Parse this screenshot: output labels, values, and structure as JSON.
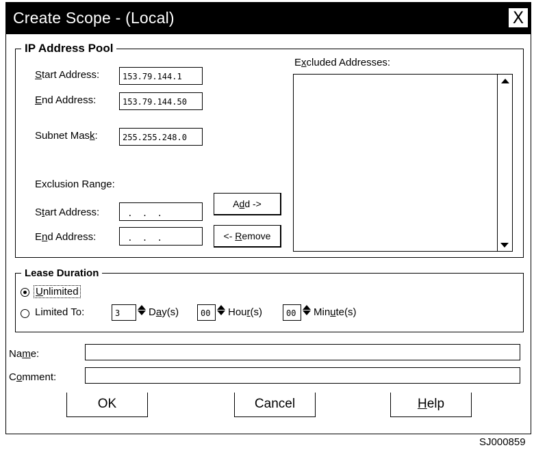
{
  "window": {
    "title": "Create Scope - (Local)",
    "close_label": "X"
  },
  "ip_pool": {
    "legend": "IP Address Pool",
    "start_address_label": [
      "",
      "S",
      "tart Address:"
    ],
    "start_address_value": "153.79.144.1",
    "end_address_label": [
      "",
      "E",
      "nd Address:"
    ],
    "end_address_value": "153.79.144.50",
    "subnet_mask_label": [
      "Subnet Mas",
      "k",
      ":"
    ],
    "subnet_mask_value": "255.255.248.0",
    "exclusion_range_label": "Exclusion Range:",
    "excl_start_label": [
      "S",
      "t",
      "art Address:"
    ],
    "excl_start_value": " .  .  . ",
    "excl_end_label": [
      "E",
      "n",
      "d Address:"
    ],
    "excl_end_value": " .  .  . ",
    "add_button": [
      "A",
      "d",
      "d ->"
    ],
    "remove_button": [
      "<- ",
      "R",
      "emove"
    ],
    "excluded_label": [
      "E",
      "x",
      "cluded Addresses:"
    ]
  },
  "lease": {
    "legend": "Lease Duration",
    "unlimited_label": [
      "",
      "U",
      "nlimited"
    ],
    "unlimited_selected": true,
    "limited_label": "Limited To:",
    "days_value": "3",
    "days_label": [
      "D",
      "a",
      "y(s)"
    ],
    "hours_value": "00",
    "hours_label": [
      "Hou",
      "r",
      "(s)"
    ],
    "minutes_value": "00",
    "minutes_label": [
      "Min",
      "u",
      "te(s)"
    ]
  },
  "form": {
    "name_label": [
      "Na",
      "m",
      "e:"
    ],
    "name_value": "",
    "comment_label": [
      "C",
      "o",
      "mment:"
    ],
    "comment_value": ""
  },
  "buttons": {
    "ok": "OK",
    "cancel": "Cancel",
    "help": [
      "",
      "H",
      "elp"
    ]
  },
  "footer_code": "SJ000859"
}
